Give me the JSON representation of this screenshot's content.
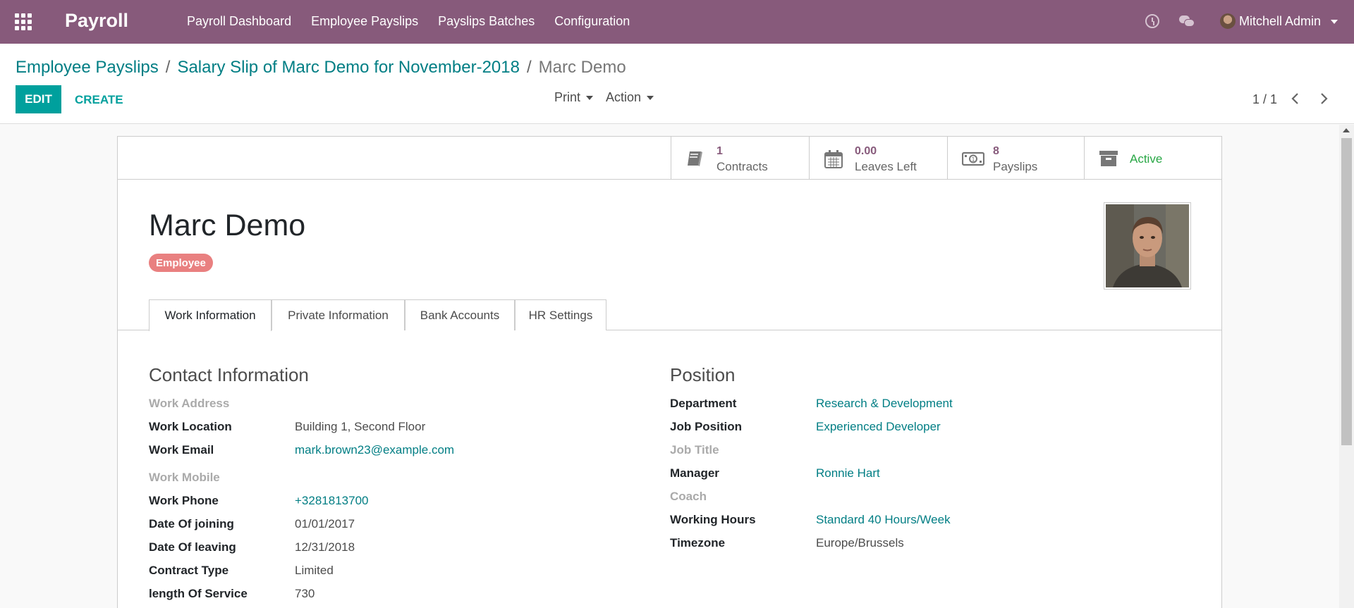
{
  "app": {
    "title": "Payroll"
  },
  "menu": [
    {
      "label": "Payroll Dashboard"
    },
    {
      "label": "Employee Payslips"
    },
    {
      "label": "Payslips Batches"
    },
    {
      "label": "Configuration"
    }
  ],
  "user": {
    "name": "Mitchell Admin"
  },
  "breadcrumb": {
    "item1": "Employee Payslips",
    "item2": "Salary Slip of Marc Demo for November-2018",
    "current": "Marc Demo",
    "separator": "/"
  },
  "toolbar": {
    "edit_label": "EDIT",
    "create_label": "CREATE",
    "print_label": "Print",
    "action_label": "Action"
  },
  "pager": {
    "value": "1 / 1"
  },
  "stat_buttons": {
    "contracts": {
      "value": "1",
      "label": "Contracts"
    },
    "leaves": {
      "value": "0.00",
      "label": "Leaves Left"
    },
    "payslips": {
      "value": "8",
      "label": "Payslips"
    },
    "active": {
      "label": "Active"
    }
  },
  "employee": {
    "name": "Marc Demo",
    "tag": "Employee"
  },
  "tabs": [
    {
      "label": "Work Information"
    },
    {
      "label": "Private Information"
    },
    {
      "label": "Bank Accounts"
    },
    {
      "label": "HR Settings"
    }
  ],
  "contact": {
    "title": "Contact Information",
    "work_address_label": "Work Address",
    "work_location_label": "Work Location",
    "work_location_value": "Building 1, Second Floor",
    "work_email_label": "Work Email",
    "work_email_value": "mark.brown23@example.com",
    "work_mobile_label": "Work Mobile",
    "work_phone_label": "Work Phone",
    "work_phone_value": "+3281813700",
    "date_joining_label": "Date Of joining",
    "date_joining_value": "01/01/2017",
    "date_leaving_label": "Date Of leaving",
    "date_leaving_value": "12/31/2018",
    "contract_type_label": "Contract Type",
    "contract_type_value": "Limited",
    "length_service_label": "length Of Service",
    "length_service_value": "730"
  },
  "position": {
    "title": "Position",
    "department_label": "Department",
    "department_value": "Research & Development",
    "job_position_label": "Job Position",
    "job_position_value": "Experienced Developer",
    "job_title_label": "Job Title",
    "manager_label": "Manager",
    "manager_value": "Ronnie Hart",
    "coach_label": "Coach",
    "working_hours_label": "Working Hours",
    "working_hours_value": "Standard 40 Hours/Week",
    "timezone_label": "Timezone",
    "timezone_value": "Europe/Brussels"
  },
  "colors": {
    "navbar": "#875a7b",
    "accent": "#00a09d",
    "link": "#017e84",
    "tag": "#e98080",
    "active": "#28a745"
  }
}
